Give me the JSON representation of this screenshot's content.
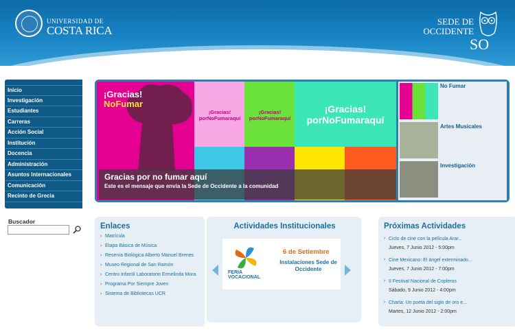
{
  "header": {
    "university_line1": "UNIVERSIDAD DE",
    "university_line2": "COSTA RICA",
    "sede_line1": "SEDE DE",
    "sede_line2": "OCCIDENTE",
    "sede_abbrev": "SO"
  },
  "nav": {
    "items": [
      {
        "label": "Inicio"
      },
      {
        "label": "Investigación"
      },
      {
        "label": "Estudiantes"
      },
      {
        "label": "Carreras"
      },
      {
        "label": "Acción Social"
      },
      {
        "label": "Institución"
      },
      {
        "label": "Docencia"
      },
      {
        "label": "Administración"
      },
      {
        "label": "Asuntos Internacionales"
      },
      {
        "label": "Comunicación"
      },
      {
        "label": "Recinto de Grecia"
      }
    ]
  },
  "search": {
    "label": "Buscador",
    "value": ""
  },
  "slider": {
    "big_slogan_line1": "¡Gracias!",
    "big_slogan_line2": "NoFumar",
    "small_slogan": "¡Gracias! porNoFumaraquí",
    "center_slogan_line1": "¡Gracias!",
    "center_slogan_line2": "porNoFumaraquí",
    "caption_title": "Gracias por no fumar aquí",
    "caption_subtitle": "Este es el mensaje que envía la Sede de Occidente a la comunidad",
    "thumbs": [
      {
        "label": "No Fumar"
      },
      {
        "label": "Artes Musicales"
      },
      {
        "label": "Investigación"
      }
    ]
  },
  "enlaces": {
    "title": "Enlaces",
    "links": [
      "Matrícula",
      "Etapa Básica de Música",
      "Reserva Biológica Alberto  Manuel Brenes",
      "Museo Regional de San Ramón",
      "Centro Infantil Laboratorio Ermelinda Mora",
      "Programa Por Siempre Joven",
      "Sistema de Bibliotecas UCR"
    ]
  },
  "actividades": {
    "title": "Actividades Institucionales",
    "date": "6 de Setiembre",
    "place": "Instalaciones Sede de Occidente",
    "logo_text_line1": "FERIA",
    "logo_text_line2": "VOCACIONAL"
  },
  "proximas": {
    "title": "Próximas Actividades",
    "events": [
      {
        "name": "Ciclo de cine con la película Arar...",
        "date": "Jueves, 7 Junio 2012 - 5:00pm"
      },
      {
        "name": "Cine Mexicano: El ángel exterminado...",
        "date": "Jueves, 7 Junio 2012 - 7:00pm"
      },
      {
        "name": "II Festival Nacional de Copleros",
        "date": "Sábado, 9 Junio 2012 - 4:00pm"
      },
      {
        "name": "Charla: Un poeta del siglo de oro e...",
        "date": "Martes, 12 Junio 2012 - 2:00pm"
      }
    ]
  },
  "colors": {
    "brand_blue": "#1a86c6",
    "nav_blue": "#0f5a86",
    "link_blue": "#1a6ea2",
    "accent_orange": "#e36a12",
    "magenta": "#e60091"
  }
}
